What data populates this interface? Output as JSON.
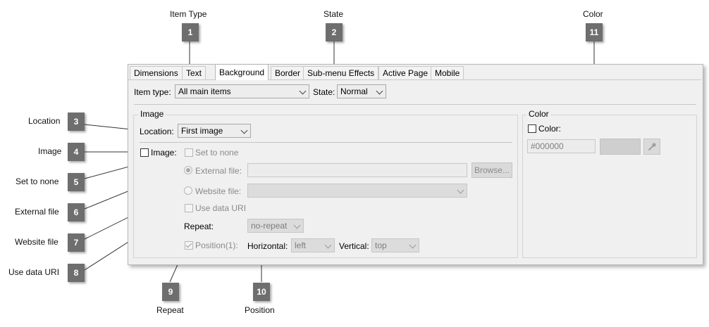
{
  "callouts": [
    {
      "n": "1",
      "label": "Item Type"
    },
    {
      "n": "2",
      "label": "State"
    },
    {
      "n": "11",
      "label": "Color"
    },
    {
      "n": "3",
      "label": "Location"
    },
    {
      "n": "4",
      "label": "Image"
    },
    {
      "n": "5",
      "label": "Set to none"
    },
    {
      "n": "6",
      "label": "External file"
    },
    {
      "n": "7",
      "label": "Website file"
    },
    {
      "n": "8",
      "label": "Use data URI"
    },
    {
      "n": "9",
      "label": "Repeat"
    },
    {
      "n": "10",
      "label": "Position"
    }
  ],
  "tabs": [
    "Dimensions",
    "Text",
    "Background",
    "Border",
    "Sub-menu Effects",
    "Active Page",
    "Mobile"
  ],
  "active_tab": "Background",
  "item_type": {
    "label": "Item type:",
    "value": "All main items"
  },
  "state": {
    "label": "State:",
    "value": "Normal"
  },
  "image_group": {
    "title": "Image",
    "location": {
      "label": "Location:",
      "value": "First image"
    },
    "image_checkbox": {
      "label": "Image:",
      "checked": false
    },
    "set_to_none": {
      "label": "Set to none",
      "checked": false
    },
    "external_file": {
      "label": "External file:",
      "value": "",
      "browse": "Browse...",
      "selected": true
    },
    "website_file": {
      "label": "Website file:",
      "value": "",
      "selected": false
    },
    "use_data_uri": {
      "label": "Use data URI",
      "checked": false
    },
    "repeat": {
      "label": "Repeat:",
      "value": "no-repeat"
    },
    "position": {
      "label": "Position(1):",
      "checked": true
    },
    "horizontal": {
      "label": "Horizontal:",
      "value": "left"
    },
    "vertical": {
      "label": "Vertical:",
      "value": "top"
    }
  },
  "color_group": {
    "title": "Color",
    "color_checkbox": {
      "label": "Color:",
      "checked": false
    },
    "color_value": "#000000",
    "icon": "eyedropper-icon"
  }
}
